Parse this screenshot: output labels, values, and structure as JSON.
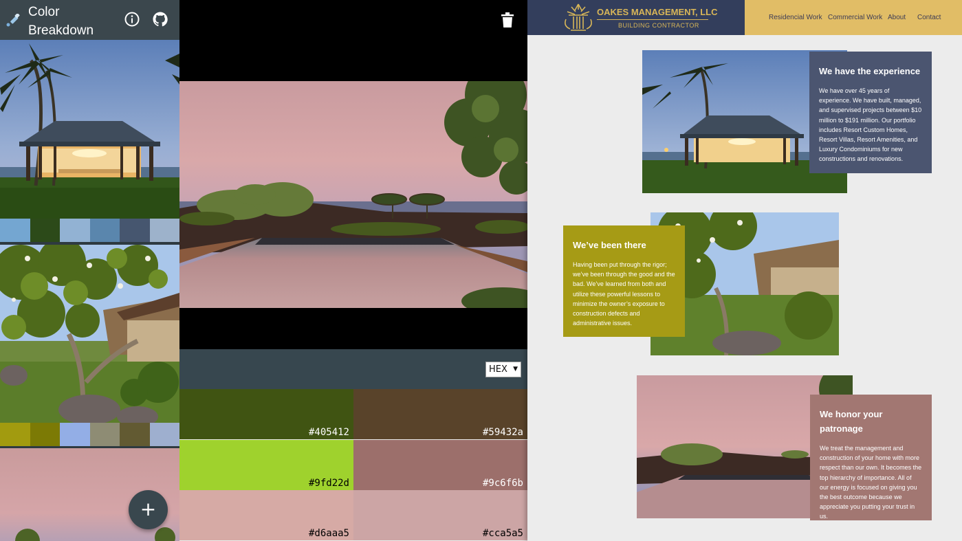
{
  "app": {
    "title": "Color Breakdown",
    "icons": {
      "tool": "color-picker-icon",
      "info": "info-icon",
      "github": "github-icon",
      "delete": "trash-icon",
      "add": "plus-icon"
    }
  },
  "sidebar": {
    "thumbnails": [
      {
        "name": "gazebo",
        "swatches": [
          "#74a6d1",
          "#2c4a19",
          "#92b2d3",
          "#5a86ad",
          "#46566f",
          "#9db2cb"
        ]
      },
      {
        "name": "garden",
        "swatches": [
          "#a29b0f",
          "#7c7a05",
          "#93aee6",
          "#8e8c74",
          "#625a32",
          "#9eafcf"
        ]
      },
      {
        "name": "pool",
        "swatches": []
      }
    ],
    "fab_label": "+"
  },
  "preview": {
    "format": {
      "selected": "HEX",
      "arrow": "▼"
    },
    "palette": [
      {
        "hex": "#405412",
        "label": "#405412",
        "text_color": "#ffffff"
      },
      {
        "hex": "#59432a",
        "label": "#59432a",
        "text_color": "#ffffff"
      },
      {
        "hex": "#9fd22d",
        "label": "#9fd22d",
        "text_color": "#000000"
      },
      {
        "hex": "#9c6f6b",
        "label": "#9c6f6b",
        "text_color": "#ffffff"
      },
      {
        "hex": "#d6aaa5",
        "label": "#d6aaa5",
        "text_color": "#000000"
      },
      {
        "hex": "#cca5a5",
        "label": "#cca5a5",
        "text_color": "#000000"
      }
    ]
  },
  "website": {
    "brand": {
      "name": "OAKES MANAGEMENT, LLC",
      "tagline": "BUILDING CONTRACTOR",
      "navy": "#333e5c",
      "gold": "#e1bd66"
    },
    "nav": [
      "Residencial Work",
      "Commercial Work",
      "About",
      "Contact"
    ],
    "sections": [
      {
        "heading": "We have the experience",
        "body": "We have over 45 years of experience. We have built, managed, and supervised projects between $10 million to $191 million. Our portfolio includes Resort Custom Homes, Resort Villas, Resort Amenities, and Luxury Condominiums for new constructions and renovations.",
        "card_color": "#4b5570"
      },
      {
        "heading": "We’ve been there",
        "body": "Having been put through the rigor; we’ve been through the good and the bad. We’ve learned from both and utilize these powerful lessons to minimize the owner’s exposure to construction defects and administrative issues.",
        "card_color": "#a69b15"
      },
      {
        "heading": "We honor your patronage",
        "body": "We treat the management and construction of your home with more respect than our own. It becomes the top hierarchy of importance. All of our energy is focused on giving you the best outcome because we appreciate you putting your trust in us.",
        "card_color": "#a27772"
      }
    ]
  }
}
